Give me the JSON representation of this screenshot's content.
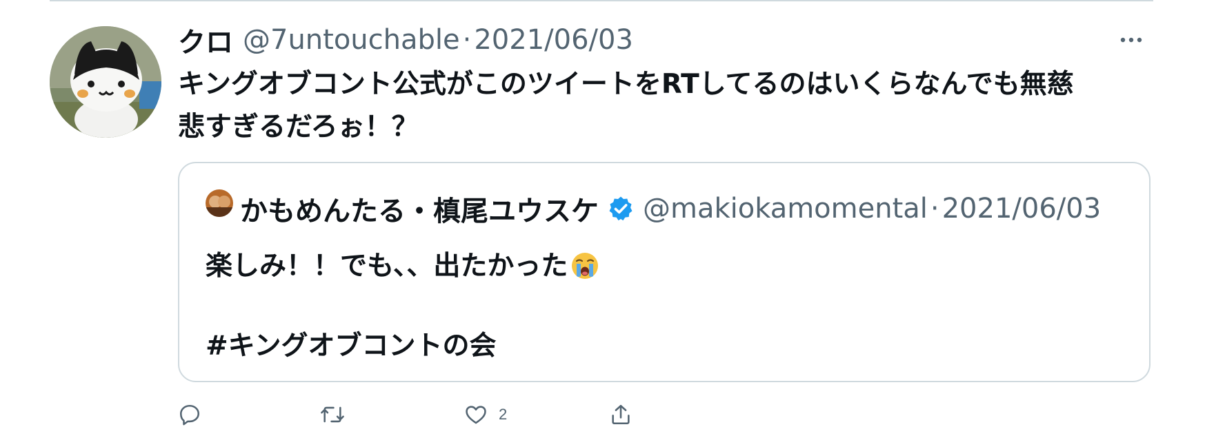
{
  "tweet": {
    "display_name": "クロ",
    "handle": "@7untouchable",
    "separator": "·",
    "date": "2021/06/03",
    "text": "キングオブコント公式がこのツイートをRTしてるのはいくらなんでも無慈\n悲すぎるだろぉ！？"
  },
  "quote": {
    "display_name": "かもめんたる・槙尾ユウスケ",
    "handle": "@makiokamomental",
    "separator": "·",
    "date": "2021/06/03",
    "text_line1": "楽しみ！！でも、、出たかった",
    "hashtag": "#キングオブコントの会"
  },
  "actions": {
    "like_count": "2"
  },
  "icons": {
    "more": "more-horizontal-icon",
    "verified": "verified-badge-icon",
    "reply": "reply-icon",
    "retweet": "retweet-icon",
    "like": "heart-icon",
    "share": "share-icon",
    "emoji": "loudly-crying-face-icon"
  },
  "colors": {
    "text_primary": "#0f1419",
    "text_secondary": "#536471",
    "border": "#cfd9de",
    "verified_blue": "#1d9bf0"
  }
}
